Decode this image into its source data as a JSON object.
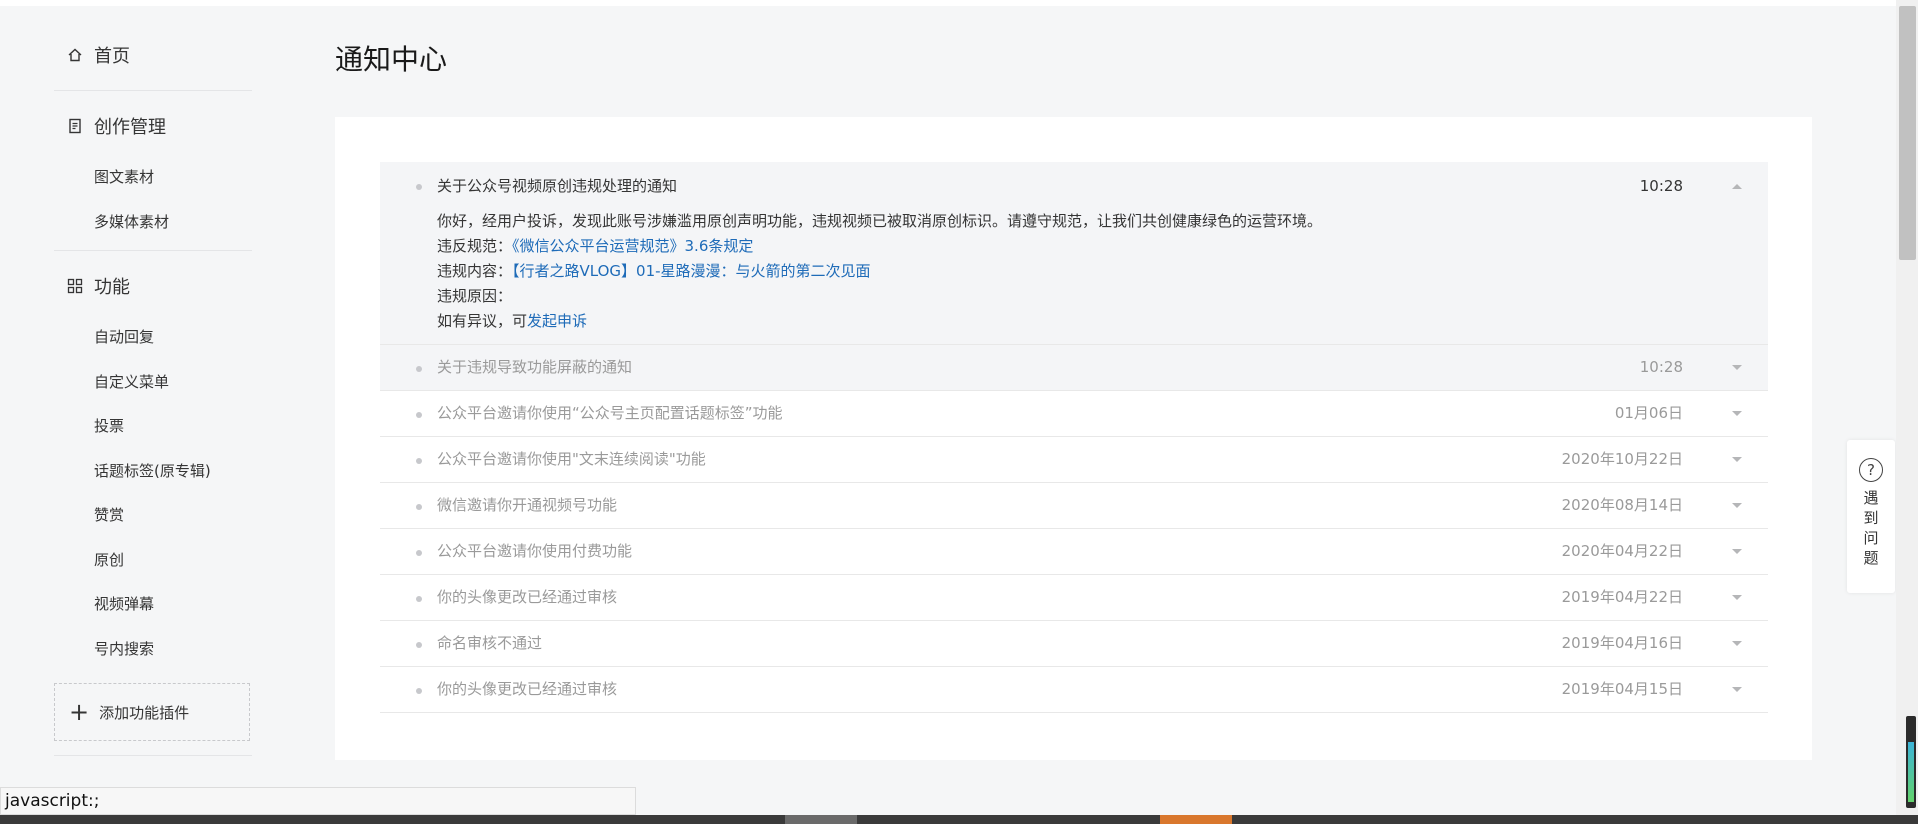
{
  "sidebar": {
    "home": "首页",
    "creation": "创作管理",
    "creation_items": [
      "图文素材",
      "多媒体素材"
    ],
    "features": "功能",
    "feature_items": [
      "自动回复",
      "自定义菜单",
      "投票",
      "话题标签(原专辑)",
      "赞赏",
      "原创",
      "视频弹幕",
      "号内搜索"
    ],
    "add_plugin": "添加功能插件"
  },
  "page": {
    "title": "通知中心"
  },
  "notifications": {
    "expanded": {
      "title": "关于公众号视频原创违规处理的通知",
      "date": "10:28",
      "intro": "你好，经用户投诉，发现此账号涉嫌滥用原创声明功能，违规视频已被取消原创标识。请遵守规范，让我们共创健康绿色的运营环境。",
      "rule_label": "违反规范：",
      "rule_link": "《微信公众平台运营规范》3.6条规定",
      "content_label": "违规内容：",
      "content_link": "【行者之路VLOG】01-星路漫漫：与火箭的第二次见面",
      "reason_label": "违规原因：",
      "appeal_prefix": "如有异议，可",
      "appeal_link": "发起申诉"
    },
    "items": [
      {
        "title": "关于违规导致功能屏蔽的通知",
        "date": "10:28"
      },
      {
        "title": "公众平台邀请你使用“公众号主页配置话题标签”功能",
        "date": "01月06日"
      },
      {
        "title": "公众平台邀请你使用\"文末连续阅读\"功能",
        "date": "2020年10月22日"
      },
      {
        "title": "微信邀请你开通视频号功能",
        "date": "2020年08月14日"
      },
      {
        "title": "公众平台邀请你使用付费功能",
        "date": "2020年04月22日"
      },
      {
        "title": "你的头像更改已经通过审核",
        "date": "2019年04月22日"
      },
      {
        "title": "命名审核不通过",
        "date": "2019年04月16日"
      },
      {
        "title": "你的头像更改已经通过审核",
        "date": "2019年04月15日"
      }
    ]
  },
  "help": {
    "text": "遇到问题"
  },
  "status_bar": {
    "text": "javascript:;"
  }
}
